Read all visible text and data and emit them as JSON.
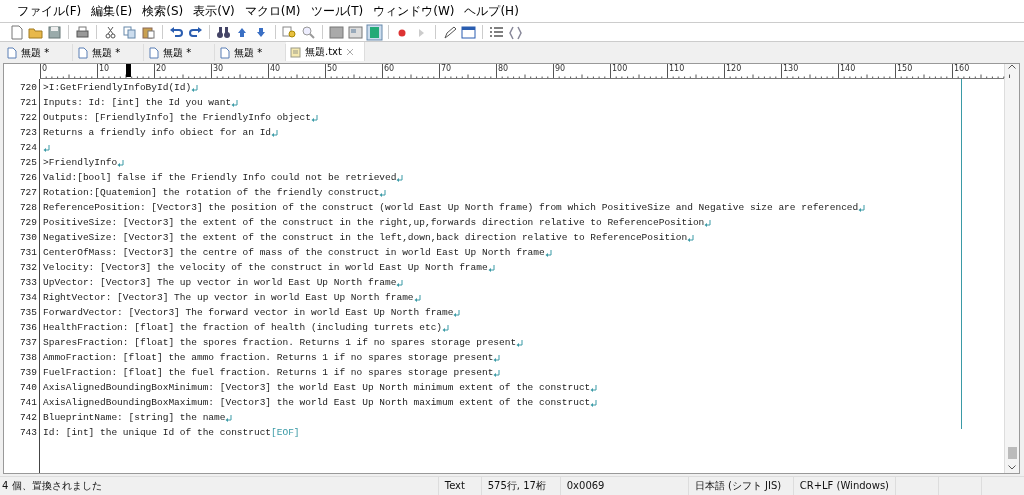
{
  "menu": [
    "ファイル(F)",
    "編集(E)",
    "検索(S)",
    "表示(V)",
    "マクロ(M)",
    "ツール(T)",
    "ウィンドウ(W)",
    "ヘルプ(H)"
  ],
  "tabs": [
    {
      "label": "無題 *",
      "selected": false
    },
    {
      "label": "無題 *",
      "selected": false
    },
    {
      "label": "無題 *",
      "selected": false
    },
    {
      "label": "無題 *",
      "selected": false
    },
    {
      "label": "無題.txt",
      "selected": true
    }
  ],
  "ruler": {
    "labels": [
      "0",
      "10",
      "20",
      "30",
      "40",
      "50",
      "60",
      "70",
      "80",
      "90",
      "100",
      "110",
      "120",
      "130",
      "140",
      "150",
      "160"
    ],
    "cursor": {
      "level": 0.09
    }
  },
  "lines": [
    {
      "number": "720",
      "text": ">I:GetFriendlyInfoById(Id)",
      "eol_mark": true
    },
    {
      "number": "721",
      "text": "Inputs: Id: [int] the Id you want",
      "eol_mark": true
    },
    {
      "number": "722",
      "text": "Outputs: [FriendlyInfo] the FriendlyInfo object",
      "eol_mark": true
    },
    {
      "number": "723",
      "text": "Returns a friendly info obiect for an Id",
      "eol_mark": true
    },
    {
      "number": "724",
      "eol_mark": true
    },
    {
      "number": "725",
      "text": ">FriendlyInfo",
      "eol_mark": true
    },
    {
      "number": "726",
      "text": "Valid:[bool] false if the Friendly Info could not be retrieved",
      "eol_mark": true
    },
    {
      "number": "727",
      "text": "Rotation:[Quatemion] the rotation of the friendly construct",
      "eol_mark": true
    },
    {
      "number": "728",
      "text": "ReferencePosition: [Vector3] the position of the construct (world East Up North frame) from which PositiveSize and Negative size are referenced",
      "eol_mark": true
    },
    {
      "number": "729",
      "text": "PositiveSize: [Vector3] the extent of the construct in the right,up,forwards direction relative to ReferencePosition",
      "eol_mark": true
    },
    {
      "number": "730",
      "text": "NegativeSize: [Vector3] the extent of the construct in the left,down,back direction relative to ReferencePosition",
      "eol_mark": true
    },
    {
      "number": "731",
      "text": "CenterOfMass: [Vector3] the centre of mass of the construct in world East Up North frame",
      "eol_mark": true
    },
    {
      "number": "732",
      "text": "Velocity: [Vector3] the velocity of the construct in world East Up North frame",
      "eol_mark": true
    },
    {
      "number": "733",
      "text": "UpVector: [Vector3] The up vector in world East Up North frame",
      "eol_mark": true
    },
    {
      "number": "734",
      "text": "RightVector: [Vector3] The up vector in world East Up North frame",
      "eol_mark": true
    },
    {
      "number": "735",
      "text": "ForwardVector: [Vector3] The forward vector in world East Up North frame",
      "eol_mark": true
    },
    {
      "number": "736",
      "text": "HealthFraction: [float] the fraction of health (including turrets etc)",
      "eol_mark": true
    },
    {
      "number": "737",
      "text": "SparesFraction: [float] the spores fraction. Returns 1 if no spares storage present",
      "eol_mark": true
    },
    {
      "number": "738",
      "text": "AmmoFraction: [float] the ammo fraction. Returns 1 if no spares storage present",
      "eol_mark": true
    },
    {
      "number": "739",
      "text": "FuelFraction: [float] the fuel fraction. Returns 1 if no spares storage present",
      "eol_mark": true
    },
    {
      "number": "740",
      "text": "AxisAlignedBoundingBoxMinimum: [Vector3] the world East Up North minimum extent of the construct",
      "eol_mark": true
    },
    {
      "number": "741",
      "text": "AxisAlignedBoundingBoxMaximum: [Vector3] the world East Up North maximum extent of the construct",
      "eol_mark": true
    },
    {
      "number": "742",
      "text": "BlueprintName: [string] the name",
      "eol_mark": true
    },
    {
      "number": "743",
      "text": "Id: [int] the unique Id of the construct",
      "eof_marker": "[EOF]"
    }
  ],
  "status_bar": [
    "4 個、置換されました",
    "Text",
    "575行, 17桁",
    "0x0069",
    "日本語 (シフト JIS)",
    "CR+LF (Windows)"
  ]
}
